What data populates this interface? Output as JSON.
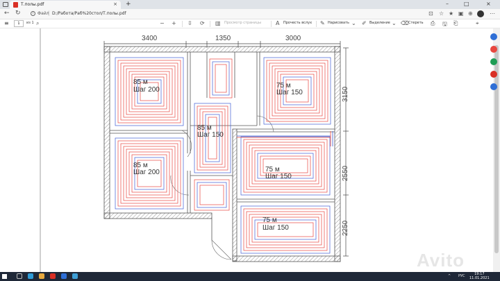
{
  "browser": {
    "tab_title": "Т.полы.pdf",
    "tab_close": "×",
    "new_tab": "+",
    "window_controls": [
      "–",
      "□",
      "×"
    ],
    "address": {
      "file_label": "Файл",
      "url": "D:/Работа/Раб%20стол/Т.полы.pdf"
    }
  },
  "pdf_toolbar": {
    "page_current": "1",
    "page_of": "из 1",
    "page_view": "Просмотр страницы",
    "read_aloud": "Прочесть вслух",
    "draw": "Нарисовать",
    "highlight": "Выделение",
    "erase": "Стереть"
  },
  "plan": {
    "dimensions_top": [
      "3400",
      "1350",
      "3000"
    ],
    "dimensions_right": [
      "3150",
      "2550",
      "2250"
    ],
    "rooms": [
      {
        "length": "85 м",
        "step": "Шаг 200"
      },
      {
        "length": "75 м",
        "step": "Шаг 150"
      },
      {
        "length": "85 м",
        "step": "Шаг 150"
      },
      {
        "length": "85 м",
        "step": "Шаг 200"
      },
      {
        "length": "75 м",
        "step": "Шаг 150"
      },
      {
        "length": "75 м",
        "step": "Шаг 150"
      }
    ],
    "colors": {
      "supply": "#e8473f",
      "return": "#3f5fd6",
      "wall": "#555555"
    }
  },
  "taskbar": {
    "lang": "РУС",
    "time": "19:17",
    "date": "11.01.2021"
  },
  "watermark": "Avito"
}
